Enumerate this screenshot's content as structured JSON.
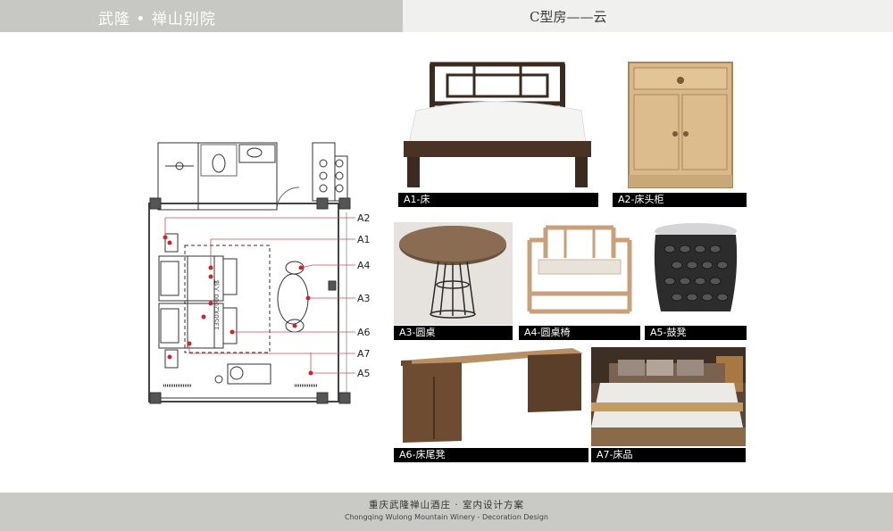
{
  "header": {
    "project": "武隆 • 禅山别院",
    "room": "C型房——云"
  },
  "plan": {
    "labels": [
      "A2",
      "A1",
      "A4",
      "A3",
      "A6",
      "A7",
      "A5"
    ],
    "bed_dimension": "1350X2000 人体"
  },
  "items": [
    {
      "code": "A1-床"
    },
    {
      "code": "A2-床头柜"
    },
    {
      "code": "A3-圆桌"
    },
    {
      "code": "A4-圆桌椅"
    },
    {
      "code": "A5-鼓凳"
    },
    {
      "code": "A6-床尾凳"
    },
    {
      "code": "A7-床品"
    }
  ],
  "footer": {
    "cn": "重庆武隆禅山酒庄 · 室内设计方案",
    "en": "Chongqing Wulong Mountain Winery - Decoration Design"
  }
}
